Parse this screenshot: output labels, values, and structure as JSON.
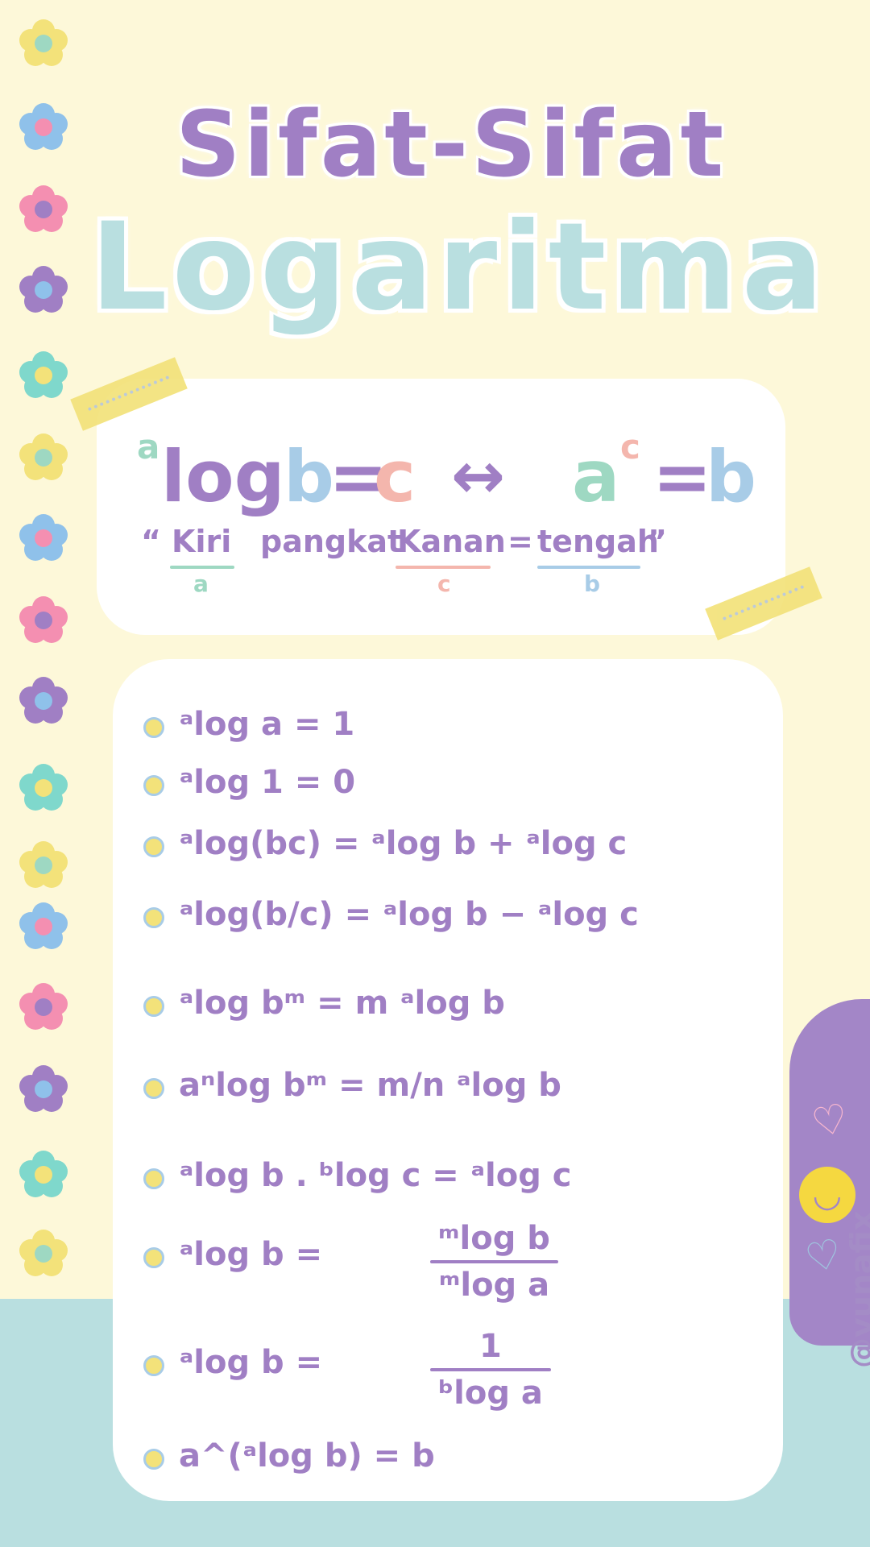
{
  "title": {
    "line1": "Sifat-Sifat",
    "line2": "Logaritma"
  },
  "definition": {
    "base_sup": "a",
    "log": "log",
    "b": "b",
    "eq": "=",
    "c": "c",
    "arrow": "↔",
    "a": "a",
    "c_sup": "c",
    "b2": "b",
    "mnemonic": {
      "open_quote": "“",
      "kiri": "Kiri",
      "kiri_sub": "a",
      "pangkat": "pangkat",
      "kanan": "Kanan",
      "kanan_sub": "c",
      "equals": "=",
      "tengah": "tengah",
      "tengah_sub": "b",
      "close_quote": "”"
    }
  },
  "properties": [
    {
      "text": "ᵃlog a = 1"
    },
    {
      "text": "ᵃlog 1 = 0"
    },
    {
      "text": "ᵃlog(bc) = ᵃlog b + ᵃlog c"
    },
    {
      "text": "ᵃlog(b/c) = ᵃlog b − ᵃlog c"
    },
    {
      "text": "ᵃlog bᵐ = m ᵃlog b"
    },
    {
      "text": "aⁿlog bᵐ = m/n ᵃlog b"
    },
    {
      "text": "ᵃlog b . ᵇlog c = ᵃlog c"
    },
    {
      "lhs": "ᵃlog b =",
      "num": "ᵐlog b",
      "den": "ᵐlog a"
    },
    {
      "lhs": "ᵃlog b =",
      "num": "1",
      "den": "ᵇlog a"
    },
    {
      "text": "a^(ᵃlog b) = b"
    }
  ],
  "signature": "@yunafix",
  "colors": {
    "background": "#fdf8d9",
    "purple": "#a07fc4",
    "mint": "#9ed8c2",
    "peach": "#f4b6ad",
    "sky": "#a8cce7",
    "teal_band": "#b9dfe0",
    "yellow": "#f3e27a"
  },
  "icons": [
    "flower-icon",
    "heart-icon",
    "smiley-icon",
    "star-bullet-icon"
  ]
}
